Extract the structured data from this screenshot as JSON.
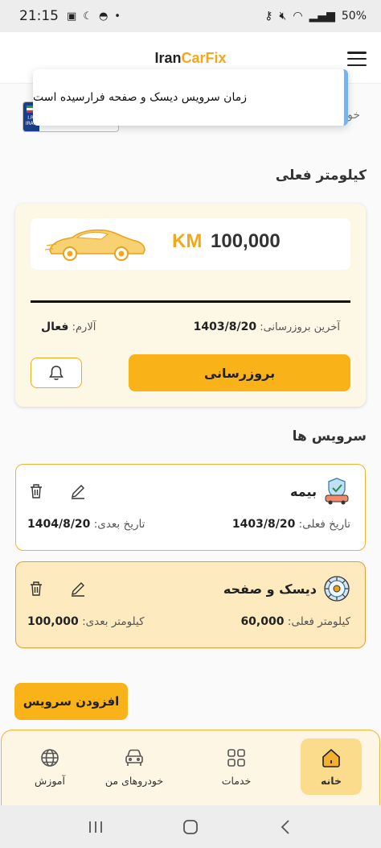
{
  "status_bar": {
    "time": "21:15",
    "battery": "50%"
  },
  "header": {
    "logo_part1": "Iran",
    "logo_part2": "CarFix"
  },
  "toast": {
    "message": "زمان سرویس دیسک و صفحه فرارسیده است"
  },
  "vehicle_row": {
    "partial_text": "خو",
    "plate_country": "I.R. IRAN"
  },
  "km_section": {
    "title": "کیلومتر فعلی",
    "value": "100,000",
    "unit": "KM",
    "last_update_label": "آخرین بروزرسانی:",
    "last_update_value": "1403/8/20",
    "alarm_label": "آلارم:",
    "alarm_value": "فعال",
    "update_button": "بروزرسانی"
  },
  "services_section": {
    "title": "سرویس ها",
    "items": [
      {
        "name": "بیمه",
        "icon": "insurance-car-icon",
        "current_label": "تاریخ فعلی:",
        "current_value": "1403/8/20",
        "next_label": "تاریخ بعدی:",
        "next_value": "1404/8/20",
        "overdue": false
      },
      {
        "name": "دیسک و صفحه",
        "icon": "clutch-disc-icon",
        "current_label": "کیلومتر فعلی:",
        "current_value": "60,000",
        "next_label": "کیلومتر بعدی:",
        "next_value": "100,000",
        "overdue": true
      }
    ],
    "add_button": "افزودن سرویس"
  },
  "bottom_nav": {
    "items": [
      {
        "label": "خانه",
        "icon": "home-icon",
        "active": true
      },
      {
        "label": "خدمات",
        "icon": "grid-icon",
        "active": false
      },
      {
        "label": "خودروهای من",
        "icon": "car-icon",
        "active": false
      },
      {
        "label": "آموزش",
        "icon": "globe-icon",
        "active": false
      }
    ]
  },
  "colors": {
    "accent": "#fab219",
    "brand_text": "#f4a817",
    "alert_bg": "#fdebbf"
  }
}
